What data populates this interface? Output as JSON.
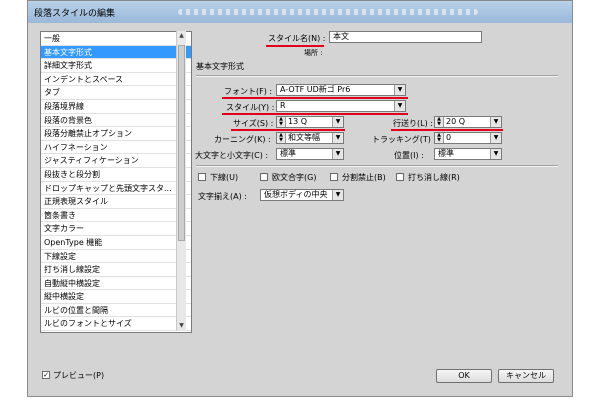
{
  "window": {
    "title": "段落スタイルの編集"
  },
  "list": {
    "items": [
      "一般",
      "基本文字形式",
      "詳細文字形式",
      "インデントとスペース",
      "タブ",
      "段落境界線",
      "段落の背景色",
      "段落分離禁止オプション",
      "ハイフネーション",
      "ジャスティフィケーション",
      "段抜きと段分割",
      "ドロップキャップと先頭文字スタ...",
      "正規表現スタイル",
      "箇条書き",
      "文字カラー",
      "OpenType 機能",
      "下線設定",
      "打ち消し線設定",
      "自動縦中横設定",
      "縦中横設定",
      "ルビの位置と間隔",
      "ルビのフォントとサイズ"
    ],
    "selected_index": 1
  },
  "style_name": {
    "label": "スタイル名(N) :",
    "value": "本文"
  },
  "location": {
    "label": "場所 :"
  },
  "section": {
    "title": "基本文字形式"
  },
  "font": {
    "label": "フォント(F) :",
    "value": "A-OTF UD新ゴ Pr6"
  },
  "style": {
    "label": "スタイル(Y) :",
    "value": "R"
  },
  "size": {
    "label": "サイズ(S) :",
    "value": "13 Q"
  },
  "leading": {
    "label": "行送り(L) :",
    "value": "20 Q"
  },
  "kerning": {
    "label": "カーニング(K) :",
    "value": "和文等幅"
  },
  "tracking": {
    "label": "トラッキング(T) :",
    "value": "0"
  },
  "case": {
    "label": "大文字と小文字(C) :",
    "value": "標準"
  },
  "position": {
    "label": "位置(I) :",
    "value": "標準"
  },
  "checks": {
    "underline": "下線(U)",
    "ligature": "欧文合字(G)",
    "nobreak": "分割禁止(B)",
    "strike": "打ち消し線(R)"
  },
  "align": {
    "label": "文字揃え(A) :",
    "value": "仮想ボディの中央"
  },
  "preview": {
    "label": "プレビュー(P)",
    "checked": true
  },
  "buttons": {
    "ok": "OK",
    "cancel": "キャンセル"
  },
  "colors": {
    "highlight": "#3399ff",
    "annotation": "#e0001b"
  }
}
